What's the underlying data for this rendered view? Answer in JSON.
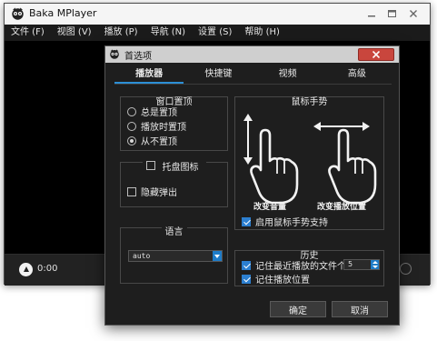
{
  "app": {
    "title": "Baka MPlayer"
  },
  "menubar": {
    "items": [
      {
        "label": "文件 (F)"
      },
      {
        "label": "视图 (V)"
      },
      {
        "label": "播放 (P)"
      },
      {
        "label": "导航 (N)"
      },
      {
        "label": "设置 (S)"
      },
      {
        "label": "帮助 (H)"
      }
    ]
  },
  "player": {
    "time": "0:00"
  },
  "dialog": {
    "title": "首选项",
    "tabs": [
      {
        "label": "播放器",
        "active": true
      },
      {
        "label": "快捷键",
        "active": false
      },
      {
        "label": "视频",
        "active": false
      },
      {
        "label": "高级",
        "active": false
      }
    ],
    "window_pin": {
      "title": "窗口置顶",
      "options": [
        {
          "label": "总是置顶",
          "selected": false
        },
        {
          "label": "播放时置顶",
          "selected": false
        },
        {
          "label": "从不置顶",
          "selected": true
        }
      ]
    },
    "tray": {
      "title": "托盘图标",
      "checked": false,
      "hide_popup": {
        "label": "隐藏弹出",
        "checked": false
      }
    },
    "language": {
      "title": "语言",
      "value": "auto"
    },
    "gestures": {
      "title": "鼠标手势",
      "vertical_label": "改变音量",
      "horizontal_label": "改变播放位置",
      "enable": {
        "label": "启用鼠标手势支持",
        "checked": true
      }
    },
    "history": {
      "title": "历史",
      "remember_recent": {
        "label": "记住最近播放的文件个数",
        "checked": true,
        "value": "5"
      },
      "remember_position": {
        "label": "记住播放位置",
        "checked": true
      }
    },
    "buttons": {
      "ok": "确定",
      "cancel": "取消"
    }
  }
}
